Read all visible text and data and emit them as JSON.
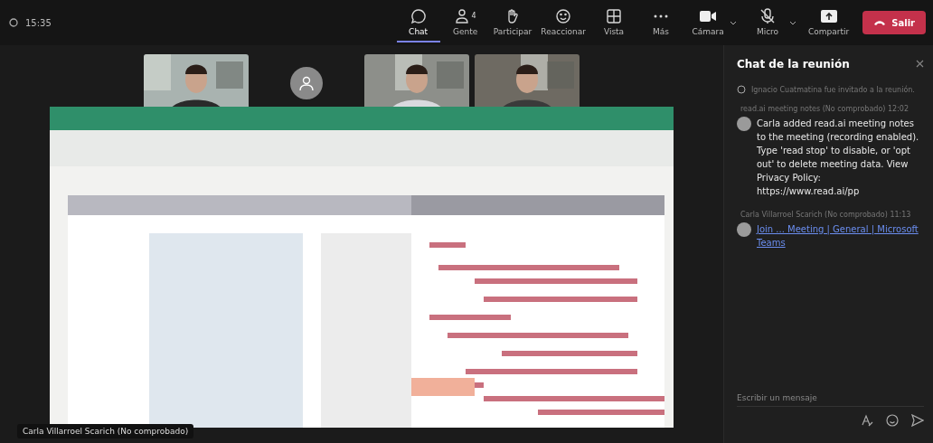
{
  "meeting": {
    "time": "15:35"
  },
  "toolbar": [
    {
      "label": "Chat",
      "selected": true
    },
    {
      "label": "Gente",
      "count": "4",
      "selected": false
    },
    {
      "label": "Participar",
      "selected": false
    },
    {
      "label": "Reaccionar",
      "selected": false
    },
    {
      "label": "Vista",
      "selected": false
    },
    {
      "label": "Más",
      "selected": false
    }
  ],
  "devices": [
    {
      "label": "Cámara",
      "muted": false
    },
    {
      "label": "Micro",
      "muted": true
    },
    {
      "label": "Compartir"
    }
  ],
  "leave_button": {
    "label": "Salir"
  },
  "participants": [
    {
      "kind": "video"
    },
    {
      "kind": "avatar"
    },
    {
      "kind": "video"
    },
    {
      "kind": "video"
    }
  ],
  "shared_screen": {
    "kind": "picture",
    "presenter": "Carla Villarroel Scarich (No comprobado)"
  },
  "chat": {
    "title": "Chat de la reunión",
    "messages": [
      {
        "kind": "event",
        "text": "Ignacio Cuatmatina fue invitado a la reunión."
      },
      {
        "kind": "message",
        "sender": "read.ai meeting notes (No comprobado)",
        "time": "12:02",
        "text": "Carla added read.ai meeting notes to the meeting (recording enabled). Type 'read stop' to disable, or 'opt out' to delete meeting data. View Privacy Policy: https://www.read.ai/pp"
      },
      {
        "kind": "link",
        "sender": "Carla Villarroel Scarich (No comprobado)",
        "time": "11:13",
        "text": "Join ... Meeting | General | Microsoft Teams"
      }
    ],
    "composer": {
      "placeholder": "Escribir un mensaje"
    }
  }
}
